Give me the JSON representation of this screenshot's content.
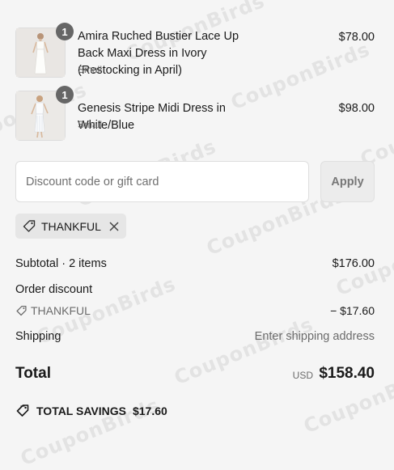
{
  "watermark": "CouponBirds",
  "items": [
    {
      "quantity": "1",
      "name": "Amira Ruched Bustier Lace Up Back Maxi Dress in Ivory (Restocking in April)",
      "variant": "Small",
      "price": "$78.00"
    },
    {
      "quantity": "1",
      "name": "Genesis Stripe Midi Dress in White/Blue",
      "variant": "Small",
      "price": "$98.00"
    }
  ],
  "discount": {
    "placeholder": "Discount code or gift card",
    "apply_label": "Apply",
    "applied_code": "THANKFUL"
  },
  "summary": {
    "subtotal_label": "Subtotal · 2 items",
    "subtotal_value": "$176.00",
    "order_discount_label": "Order discount",
    "discount_code": "THANKFUL",
    "discount_value": "− $17.60",
    "shipping_label": "Shipping",
    "shipping_value": "Enter shipping address",
    "total_label": "Total",
    "currency": "USD",
    "total_value": "$158.40",
    "savings_label": "TOTAL SAVINGS",
    "savings_value": "$17.60"
  }
}
